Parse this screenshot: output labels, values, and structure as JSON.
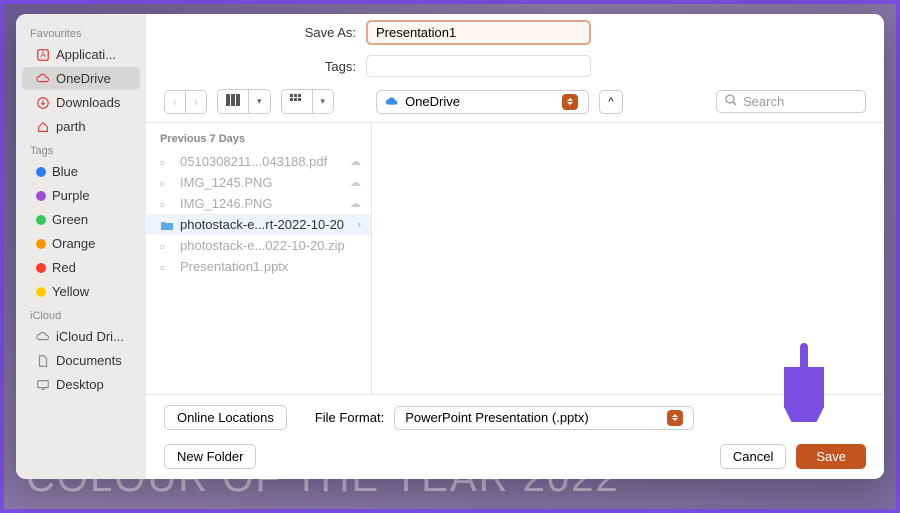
{
  "background_text": "COLOUR OF THE YEAR 2022",
  "save_as": {
    "label": "Save As:",
    "value": "Presentation1"
  },
  "tags": {
    "label": "Tags:",
    "value": ""
  },
  "location": {
    "name": "OneDrive"
  },
  "search": {
    "placeholder": "Search"
  },
  "sidebar": {
    "favourites_header": "Favourites",
    "favourites": [
      {
        "label": "Applicati...",
        "icon": "app"
      },
      {
        "label": "OneDrive",
        "icon": "cloud",
        "selected": true
      },
      {
        "label": "Downloads",
        "icon": "download"
      },
      {
        "label": "parth",
        "icon": "home"
      }
    ],
    "tags_header": "Tags",
    "tags": [
      {
        "label": "Blue",
        "color": "#2b7fff"
      },
      {
        "label": "Purple",
        "color": "#a24dd6"
      },
      {
        "label": "Green",
        "color": "#34c759"
      },
      {
        "label": "Orange",
        "color": "#ff9500"
      },
      {
        "label": "Red",
        "color": "#ff3b30"
      },
      {
        "label": "Yellow",
        "color": "#ffcc00"
      }
    ],
    "icloud_header": "iCloud",
    "icloud": [
      {
        "label": "iCloud Dri...",
        "icon": "cloud"
      },
      {
        "label": "Documents",
        "icon": "doc"
      },
      {
        "label": "Desktop",
        "icon": "desktop"
      }
    ]
  },
  "column": {
    "header": "Previous 7 Days",
    "items": [
      {
        "name": "0510308211...043188.pdf",
        "cloud": true
      },
      {
        "name": "IMG_1245.PNG",
        "cloud": true
      },
      {
        "name": "IMG_1246.PNG",
        "cloud": true
      },
      {
        "name": "photostack-e...rt-2022-10-20",
        "folder": true,
        "selected": true
      },
      {
        "name": "photostack-e...022-10-20.zip"
      },
      {
        "name": "Presentation1.pptx"
      }
    ]
  },
  "footer": {
    "online_locations": "Online Locations",
    "file_format_label": "File Format:",
    "file_format_value": "PowerPoint Presentation (.pptx)",
    "new_folder": "New Folder",
    "cancel": "Cancel",
    "save": "Save"
  }
}
